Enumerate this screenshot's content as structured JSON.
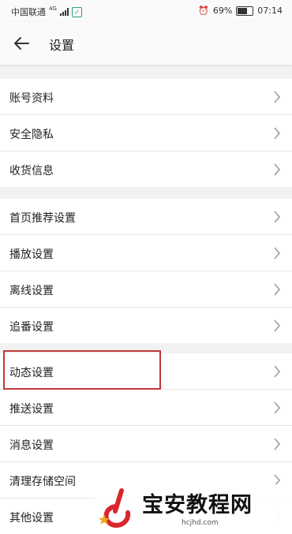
{
  "status_bar": {
    "carrier": "中国联通",
    "network": "4G",
    "battery": "69%",
    "time": "07:14"
  },
  "header": {
    "title": "设置"
  },
  "groups": [
    {
      "items": [
        {
          "label": "账号资料"
        },
        {
          "label": "安全隐私"
        },
        {
          "label": "收货信息"
        }
      ]
    },
    {
      "items": [
        {
          "label": "首页推荐设置"
        },
        {
          "label": "播放设置"
        },
        {
          "label": "离线设置"
        },
        {
          "label": "追番设置"
        }
      ]
    },
    {
      "items": [
        {
          "label": "动态设置"
        },
        {
          "label": "推送设置"
        },
        {
          "label": "消息设置"
        },
        {
          "label": "清理存储空间"
        },
        {
          "label": "其他设置"
        }
      ]
    }
  ],
  "watermark": {
    "text": "宝安教程网",
    "url": "hcjhd.com"
  },
  "colors": {
    "highlight": "#c0383a",
    "divider": "#e6e6e6",
    "background": "#f2f2f2"
  }
}
